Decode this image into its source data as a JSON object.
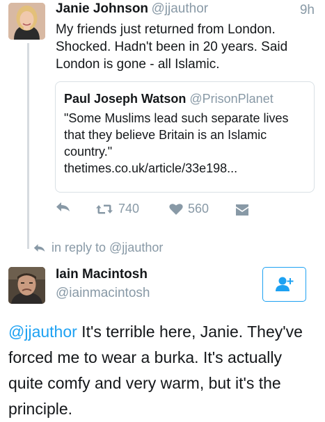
{
  "tweet": {
    "name": "Janie Johnson",
    "handle": "@jjauthor",
    "time": "9h",
    "text": "My friends just returned from London. Shocked. Hadn't been in 20 years. Said London is gone - all Islamic."
  },
  "quote": {
    "name": "Paul Joseph Watson",
    "handle": "@PrisonPlanet",
    "text": "\"Some Muslims lead such separate lives that they believe Britain is an Islamic country.\"",
    "link": "thetimes.co.uk/article/33e198..."
  },
  "actions": {
    "reply_icon": "reply-icon",
    "retweet_icon": "retweet-icon",
    "retweet_count": "740",
    "like_icon": "heart-icon",
    "like_count": "560",
    "dm_icon": "direct-message-icon"
  },
  "reply_context": {
    "text": "in reply to @jjauthor"
  },
  "reply": {
    "name": "Iain Macintosh",
    "handle": "@iainmacintosh",
    "follow_icon": "follow-user-icon",
    "mention": "@jjauthor",
    "text": " It's terrible here, Janie. They've forced me to wear a burka. It's actually quite comfy and very warm, but it's the principle."
  },
  "colors": {
    "accent": "#1da1f2",
    "muted": "#8899a6",
    "text": "#14171a",
    "border": "#d9e0e5"
  }
}
